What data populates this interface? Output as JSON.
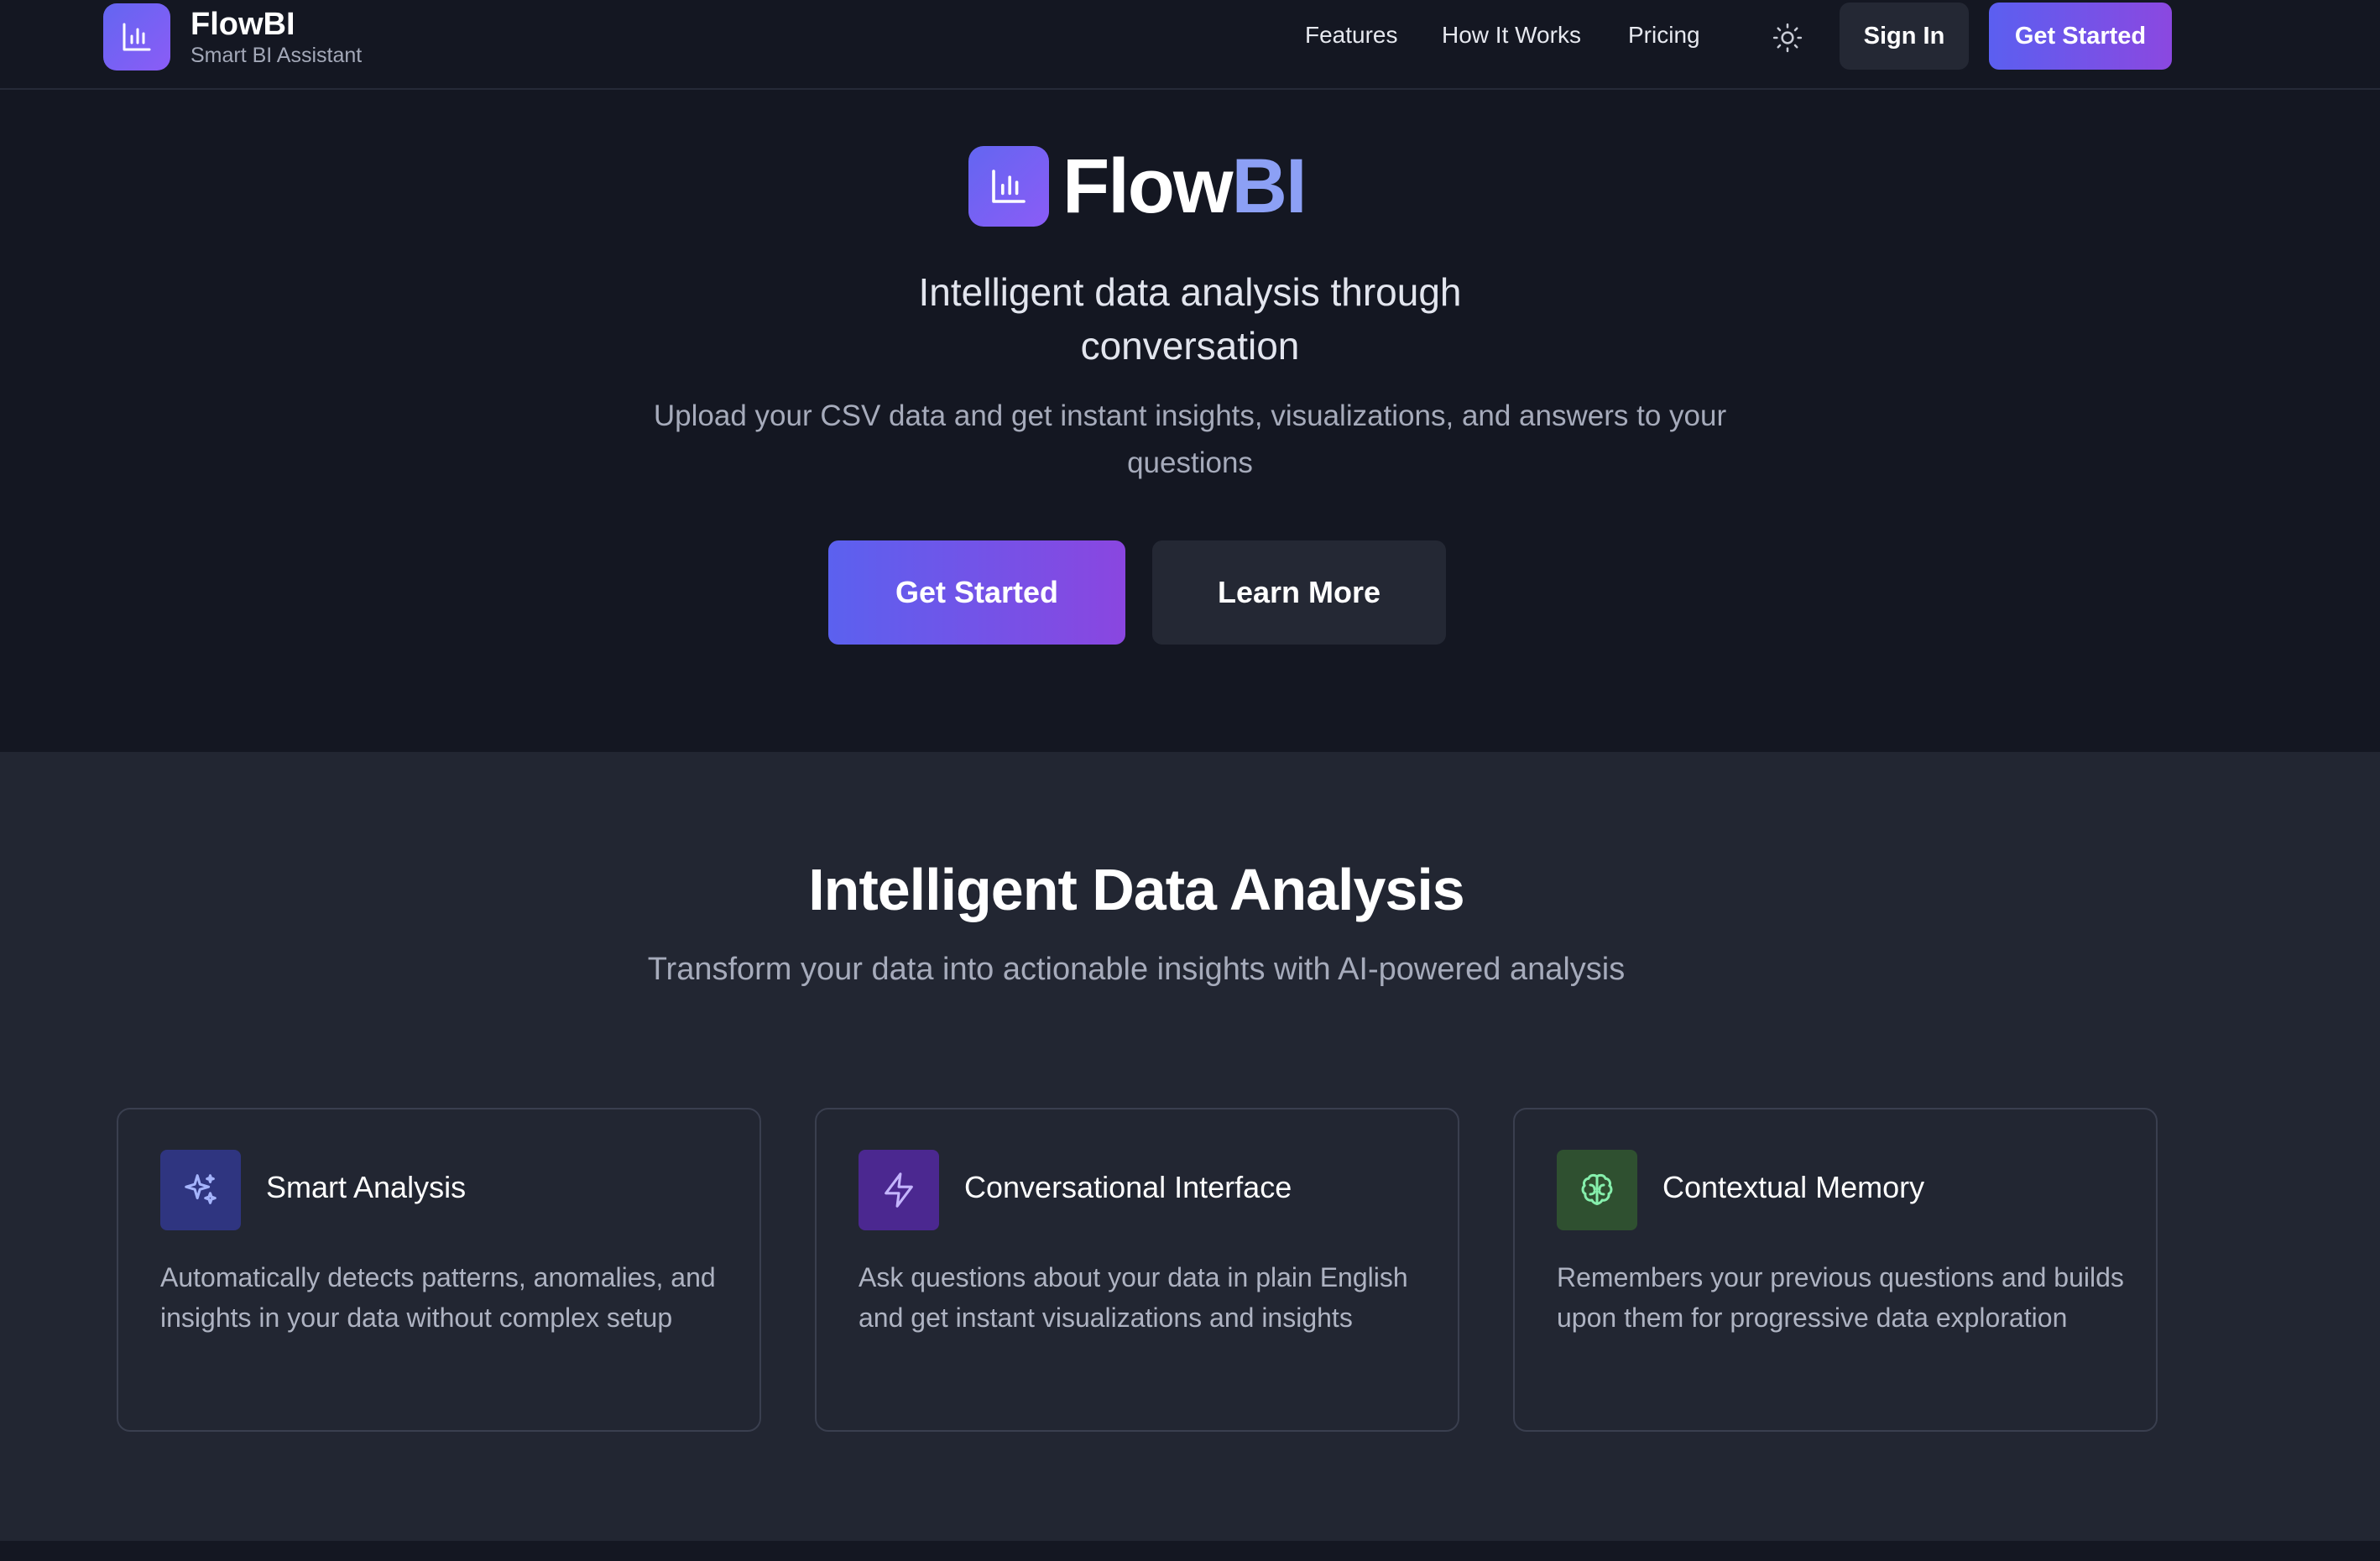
{
  "nav": {
    "brand_name": "FlowBI",
    "brand_subtitle": "Smart BI Assistant",
    "links": [
      {
        "label": "Features"
      },
      {
        "label": "How It Works"
      },
      {
        "label": "Pricing"
      }
    ],
    "theme_icon": "sun-icon",
    "sign_in_label": "Sign In",
    "get_started_label": "Get Started"
  },
  "hero": {
    "title_part1": "Flow",
    "title_part2": "BI",
    "tagline_line1": "Intelligent data analysis through",
    "tagline_line2": "conversation",
    "description_line1": "Upload your CSV data and get instant insights, visualizations, and answers to your",
    "description_line2": "questions",
    "primary_cta": "Get Started",
    "secondary_cta": "Learn More"
  },
  "features": {
    "title": "Intelligent Data Analysis",
    "subtitle": "Transform your data into actionable insights with AI-powered analysis",
    "cards": [
      {
        "icon": "sparkles-icon",
        "title": "Smart Analysis",
        "description": "Automatically detects patterns, anomalies, and insights in your data without complex setup"
      },
      {
        "icon": "lightning-icon",
        "title": "Conversational Interface",
        "description": "Ask questions about your data in plain English and get instant visualizations and insights"
      },
      {
        "icon": "brain-icon",
        "title": "Contextual Memory",
        "description": "Remembers your previous questions and builds upon them for progressive data exploration"
      }
    ]
  },
  "colors": {
    "page_bg": "#141722",
    "section_bg": "#222632",
    "accent_start": "#5b61ef",
    "accent_end": "#8a46e0",
    "brand_bi": "#8ca0f5"
  }
}
